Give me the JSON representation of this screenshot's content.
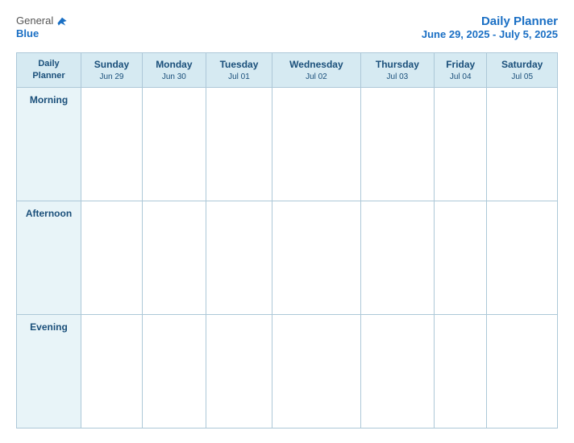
{
  "header": {
    "logo_general": "General",
    "logo_blue": "Blue",
    "title_main": "Daily Planner",
    "title_sub": "June 29, 2025 - July 5, 2025"
  },
  "table": {
    "corner_label_line1": "Daily",
    "corner_label_line2": "Planner",
    "columns": [
      {
        "day": "Sunday",
        "date": "Jun 29"
      },
      {
        "day": "Monday",
        "date": "Jun 30"
      },
      {
        "day": "Tuesday",
        "date": "Jul 01"
      },
      {
        "day": "Wednesday",
        "date": "Jul 02"
      },
      {
        "day": "Thursday",
        "date": "Jul 03"
      },
      {
        "day": "Friday",
        "date": "Jul 04"
      },
      {
        "day": "Saturday",
        "date": "Jul 05"
      }
    ],
    "rows": [
      {
        "label": "Morning"
      },
      {
        "label": "Afternoon"
      },
      {
        "label": "Evening"
      }
    ]
  }
}
